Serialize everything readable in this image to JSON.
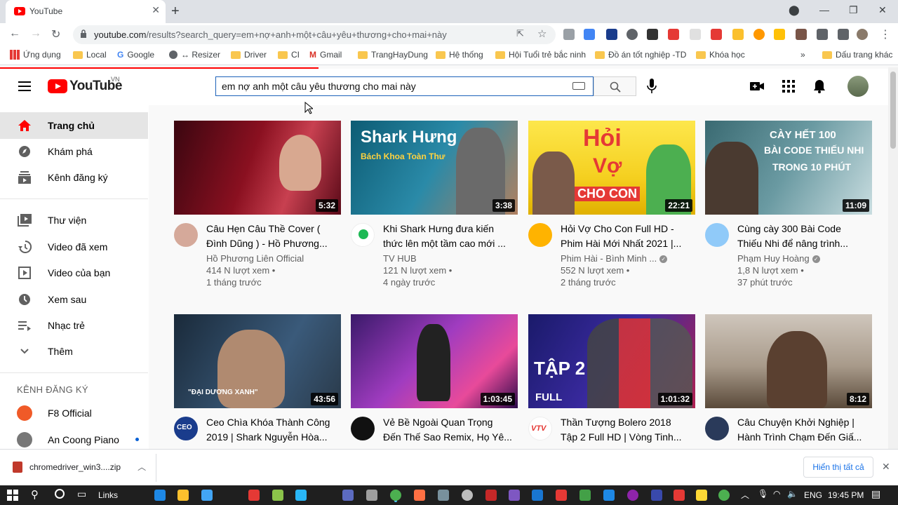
{
  "browser": {
    "tab_title": "YouTube",
    "url_host": "youtube.com",
    "url_path": "/results?search_query=em+nợ+anh+một+câu+yêu+thương+cho+mai+này"
  },
  "bookmarks": [
    {
      "label": "Ứng dụng",
      "icon": "apps-grid-icon"
    },
    {
      "label": "Local",
      "icon": "folder-icon"
    },
    {
      "label": "Google",
      "icon": "google-icon"
    },
    {
      "label": "↔ Resizer",
      "icon": "globe-icon"
    },
    {
      "label": "Driver",
      "icon": "folder-icon"
    },
    {
      "label": "CI",
      "icon": "folder-icon"
    },
    {
      "label": "Gmail",
      "icon": "gmail-icon"
    },
    {
      "label": "TrangHayDung",
      "icon": "folder-icon"
    },
    {
      "label": "Hệ thống",
      "icon": "folder-icon"
    },
    {
      "label": "Hội Tuổi trẻ bắc ninh",
      "icon": "folder-icon"
    },
    {
      "label": "Đồ án tốt nghiệp -TD",
      "icon": "folder-icon"
    },
    {
      "label": "Khóa học",
      "icon": "folder-icon"
    },
    {
      "label": "Dấu trang khác",
      "icon": "folder-icon"
    }
  ],
  "header": {
    "logo_text": "YouTube",
    "region": "VN",
    "search_value": "em nợ anh một câu yêu thương cho mai này"
  },
  "sidebar": {
    "items": [
      {
        "label": "Trang chủ",
        "icon": "home-icon"
      },
      {
        "label": "Khám phá",
        "icon": "compass-icon"
      },
      {
        "label": "Kênh đăng ký",
        "icon": "subscriptions-icon"
      },
      {
        "label": "Thư viện",
        "icon": "library-icon"
      },
      {
        "label": "Video đã xem",
        "icon": "history-icon"
      },
      {
        "label": "Video của bạn",
        "icon": "your-videos-icon"
      },
      {
        "label": "Xem sau",
        "icon": "clock-icon"
      },
      {
        "label": "Nhạc trẻ",
        "icon": "playlist-icon"
      },
      {
        "label": "Thêm",
        "icon": "chevron-down-icon"
      }
    ],
    "subs_title": "KÊNH ĐĂNG KÝ",
    "subs": [
      {
        "label": "F8 Official"
      },
      {
        "label": "An Coong Piano"
      }
    ]
  },
  "videos": [
    {
      "title1": "Câu Hẹn Câu Thề Cover (",
      "title2": "Đình Dũng ) - Hồ Phương...",
      "channel": "Hồ Phương Liên Official",
      "verified": false,
      "views": "414 N lượt xem •",
      "age": "1 tháng trước",
      "duration": "5:32"
    },
    {
      "title1": "Khi Shark Hưng đưa kiến",
      "title2": "thức lên một tầm cao mới ...",
      "channel": "TV HUB",
      "verified": false,
      "views": "121 N lượt xem •",
      "age": "4 ngày trước",
      "duration": "3:38",
      "thumb_text1": "Shark Hưng",
      "thumb_text2": "Bách Khoa Toàn Thư"
    },
    {
      "title1": "Hỏi Vợ Cho Con Full HD -",
      "title2": "Phim Hài Mới Nhất 2021 |...",
      "channel": "Phim Hài - Bình Minh ...",
      "verified": true,
      "views": "552 N lượt xem •",
      "age": "2 tháng trước",
      "duration": "22:21",
      "thumb_text1": "Hỏi",
      "thumb_text2": "Vợ",
      "thumb_text3": "CHO CON"
    },
    {
      "title1": "Cùng cày 300 Bài Code",
      "title2": "Thiếu Nhi để nâng trình...",
      "channel": "Phạm Huy Hoàng",
      "verified": true,
      "views": "1,8 N lượt xem •",
      "age": "37 phút trước",
      "duration": "11:09",
      "thumb_text1": "CÀY HẾT 100",
      "thumb_text2": "BÀI CODE THIẾU NHI",
      "thumb_text3": "TRONG 10 PHÚT"
    },
    {
      "title1": "Ceo Chìa Khóa Thành Công",
      "title2": "2019 | Shark Nguyễn Hòa...",
      "duration": "43:56",
      "thumb_text1": "\"ĐẠI DƯƠNG XANH\""
    },
    {
      "title1": "Vẻ Bề Ngoài Quan Trọng",
      "title2": "Đến Thế Sao Remix, Họ Yê...",
      "duration": "1:03:45"
    },
    {
      "title1": "Thần Tượng Bolero 2018",
      "title2": "Tập 2 Full HD | Vòng Tinh...",
      "duration": "1:01:32",
      "thumb_text1": "TẬP 2",
      "thumb_text2": "FULL"
    },
    {
      "title1": "Câu Chuyện Khởi Nghiệp |",
      "title2": "Hành Trình Chạm Đến Giấ...",
      "duration": "8:12"
    }
  ],
  "download": {
    "filename": "chromedriver_win3....zip",
    "show_all": "Hiển thị tất cả"
  },
  "taskbar": {
    "links": "Links",
    "lang": "ENG",
    "time": "19:45 PM"
  },
  "colors": {
    "brand_red": "#ff0000",
    "search_border": "#1c62b9"
  }
}
